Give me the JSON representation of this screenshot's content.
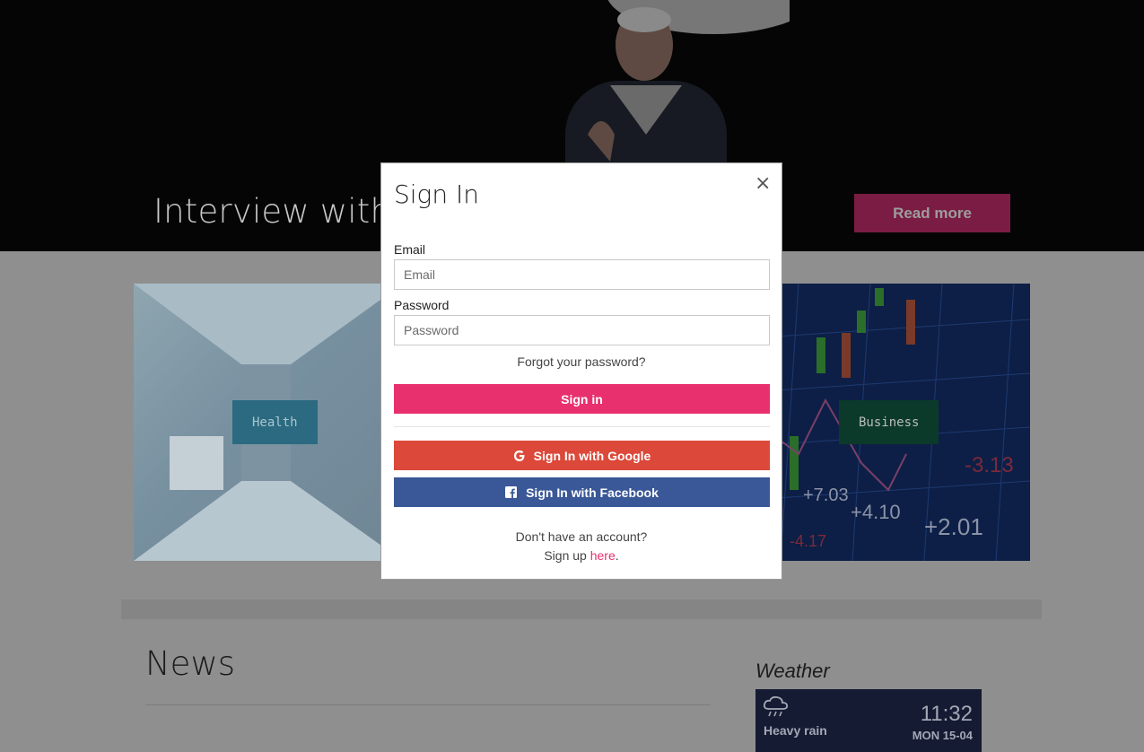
{
  "hero": {
    "title": "Interview with T",
    "read_more_label": "Read more"
  },
  "tiles": {
    "health_label": "Health",
    "business_label": "Business",
    "business_chart_numbers": [
      "-3.13",
      "+7.03",
      "+4.10",
      "+2.01",
      "-4.17"
    ]
  },
  "news": {
    "title": "News"
  },
  "weather": {
    "title": "Weather",
    "icon": "rain-cloud-icon",
    "description": "Heavy rain",
    "time": "11:32",
    "date": "MON 15-04"
  },
  "modal": {
    "title": "Sign In",
    "close_label": "×",
    "email_label": "Email",
    "email_placeholder": "Email",
    "password_label": "Password",
    "password_placeholder": "Password",
    "forgot_label": "Forgot your password?",
    "signin_label": "Sign in",
    "google_label": "Sign In with Google",
    "facebook_label": "Sign In with Facebook",
    "no_account_text": "Don't have an account?",
    "signup_prefix": "Sign up ",
    "signup_link": "here",
    "signup_suffix": "."
  },
  "colors": {
    "primary_pink": "#e8306f",
    "google_red": "#dc4839",
    "facebook_blue": "#3a5897"
  }
}
